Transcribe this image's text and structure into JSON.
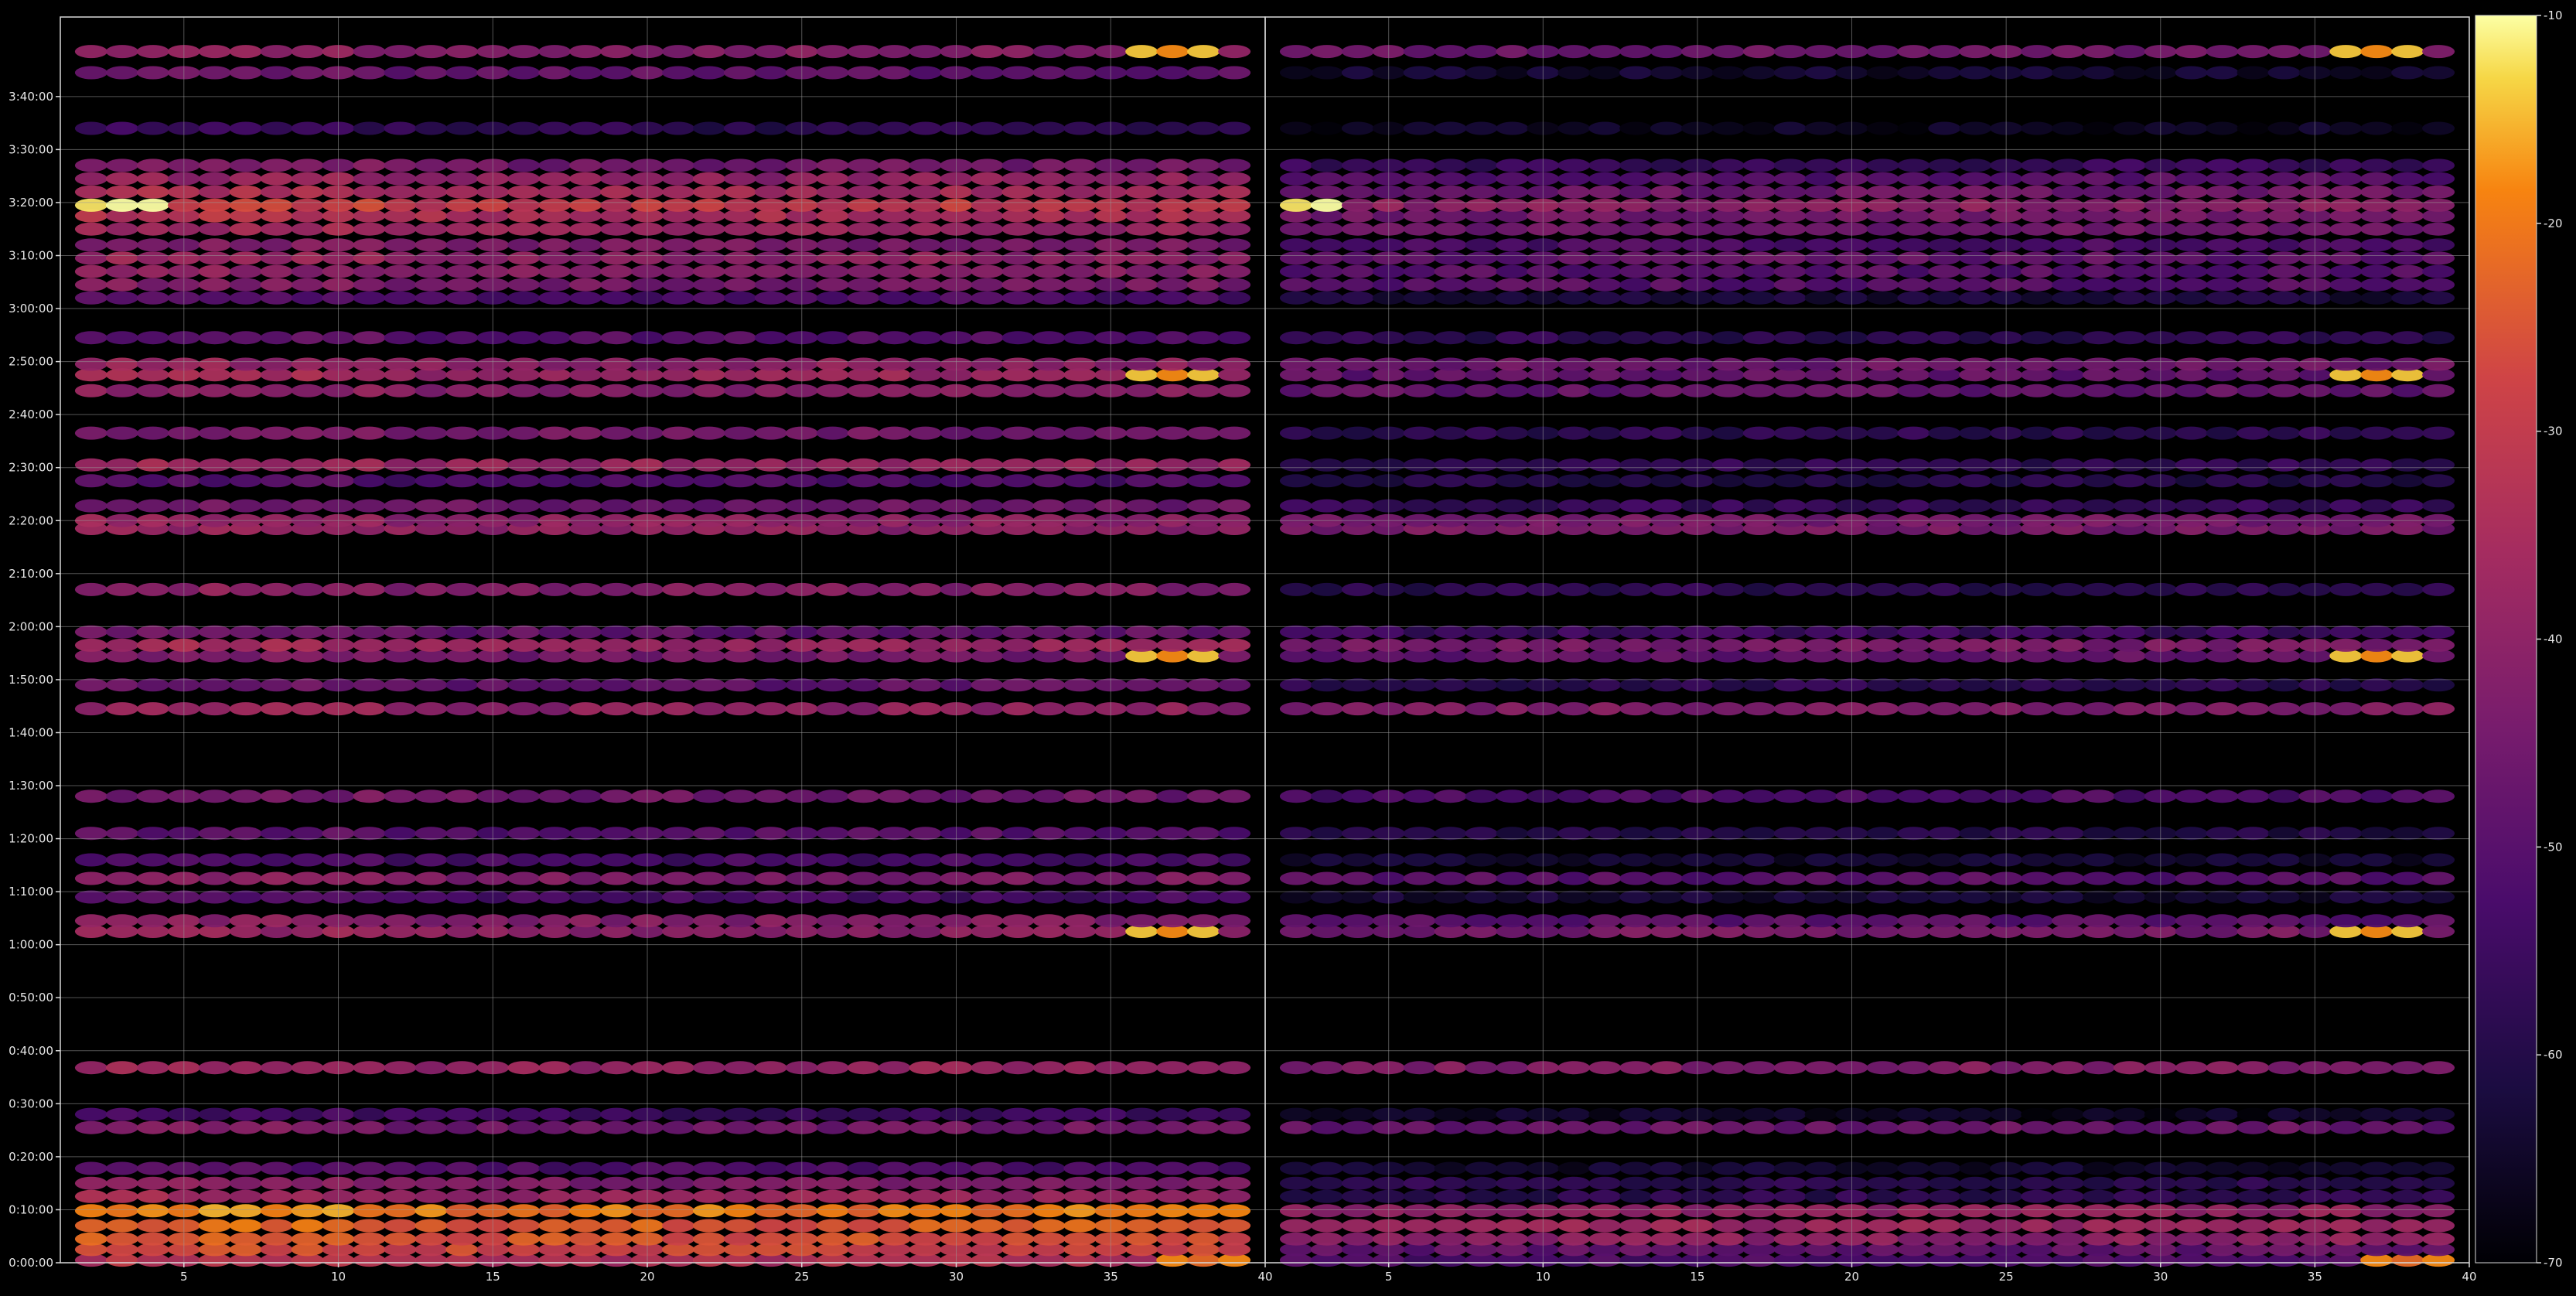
{
  "chart_data": {
    "type": "heatmap",
    "title": "",
    "colorscale": "inferno",
    "background": "#000000",
    "grid": true,
    "panels": [
      {
        "name": "",
        "xlim": [
          1,
          40
        ],
        "xticks": [
          5,
          10,
          15,
          20,
          25,
          30,
          35,
          40
        ],
        "yticks": [
          "0:00:00",
          "0:10:00",
          "0:20:00",
          "0:30:00",
          "0:40:00",
          "0:50:00",
          "1:00:00",
          "1:10:00",
          "1:20:00",
          "1:30:00",
          "1:40:00",
          "1:50:00",
          "2:00:00",
          "2:10:00",
          "2:20:00",
          "2:30:00",
          "2:40:00",
          "2:50:00",
          "3:00:00",
          "3:10:00",
          "3:20:00",
          "3:30:00",
          "3:40:00"
        ]
      },
      {
        "name": "",
        "xlim": [
          1,
          40
        ],
        "xticks": [
          5,
          10,
          15,
          20,
          25,
          30,
          35,
          40
        ],
        "yticks": []
      }
    ],
    "x_values_per_row": "2..39",
    "ylim_minutes": [
      0,
      230
    ],
    "bands": [
      {
        "t_min": 0.5,
        "panel1": -34,
        "panel2": -52,
        "peak": {
          "x": 38,
          "v": -22
        }
      },
      {
        "t_min": 2.5,
        "panel1": -28,
        "panel2": -48
      },
      {
        "t_min": 4.5,
        "panel1": -26,
        "panel2": -40
      },
      {
        "t_min": 7.0,
        "panel1": -24,
        "panel2": -38
      },
      {
        "t_min": 9.8,
        "panel1": -20,
        "panel2": -39
      },
      {
        "t_min": 12.5,
        "panel1": -38,
        "panel2": -58
      },
      {
        "t_min": 15.0,
        "panel1": -43,
        "panel2": -58
      },
      {
        "t_min": 17.8,
        "panel1": -52,
        "panel2": -64
      },
      {
        "t_min": 25.5,
        "panel1": -45,
        "panel2": -47
      },
      {
        "t_min": 28.0,
        "panel1": -55,
        "panel2": -66
      },
      {
        "t_min": 36.8,
        "panel1": -38,
        "panel2": -42
      },
      {
        "t_min": 62.5,
        "panel1": -40,
        "panel2": -44,
        "peak": {
          "x": 37,
          "v": -18
        }
      },
      {
        "t_min": 64.5,
        "panel1": -42,
        "panel2": -49
      },
      {
        "t_min": 69.0,
        "panel1": -53,
        "panel2": -63
      },
      {
        "t_min": 72.5,
        "panel1": -43,
        "panel2": -50
      },
      {
        "t_min": 76.0,
        "panel1": -53,
        "panel2": -64
      },
      {
        "t_min": 81.0,
        "panel1": -50,
        "panel2": -60
      },
      {
        "t_min": 88.0,
        "panel1": -46,
        "panel2": -52
      },
      {
        "t_min": 104.5,
        "panel1": -40,
        "panel2": -42
      },
      {
        "t_min": 109.0,
        "panel1": -48,
        "panel2": -58
      },
      {
        "t_min": 114.5,
        "panel1": -45,
        "panel2": -48,
        "peak": {
          "x": 37,
          "v": -18
        }
      },
      {
        "t_min": 116.5,
        "panel1": -38,
        "panel2": -44
      },
      {
        "t_min": 119.0,
        "panel1": -48,
        "panel2": -55
      },
      {
        "t_min": 127.0,
        "panel1": -42,
        "panel2": -58
      },
      {
        "t_min": 138.5,
        "panel1": -40,
        "panel2": -44
      },
      {
        "t_min": 140.0,
        "panel1": -40,
        "panel2": -45
      },
      {
        "t_min": 142.8,
        "panel1": -46,
        "panel2": -56
      },
      {
        "t_min": 147.5,
        "panel1": -52,
        "panel2": -60
      },
      {
        "t_min": 150.5,
        "panel1": -38,
        "panel2": -57
      },
      {
        "t_min": 156.5,
        "panel1": -45,
        "panel2": -58
      },
      {
        "t_min": 164.5,
        "panel1": -42,
        "panel2": -48
      },
      {
        "t_min": 167.5,
        "panel1": -38,
        "panel2": -48,
        "peak": {
          "x": 37,
          "v": -18
        }
      },
      {
        "t_min": 169.5,
        "panel1": -40,
        "panel2": -46
      },
      {
        "t_min": 174.5,
        "panel1": -50,
        "panel2": -58
      },
      {
        "t_min": 182.0,
        "panel1": -52,
        "panel2": -62
      },
      {
        "t_min": 184.5,
        "panel1": -44,
        "panel2": -50
      },
      {
        "t_min": 187.0,
        "panel1": -42,
        "panel2": -50
      },
      {
        "t_min": 189.5,
        "panel1": -40,
        "panel2": -48
      },
      {
        "t_min": 192.0,
        "panel1": -44,
        "panel2": -52
      },
      {
        "t_min": 195.0,
        "panel1": -38,
        "panel2": -46
      },
      {
        "t_min": 197.5,
        "panel1": -34,
        "panel2": -45
      },
      {
        "t_min": 199.5,
        "panel1": -30,
        "panel2": -40,
        "peak": {
          "x": 2,
          "v": -12
        }
      },
      {
        "t_min": 202.0,
        "panel1": -36,
        "panel2": -46
      },
      {
        "t_min": 204.5,
        "panel1": -40,
        "panel2": -50
      },
      {
        "t_min": 207.0,
        "panel1": -45,
        "panel2": -56
      },
      {
        "t_min": 214.0,
        "panel1": -58,
        "panel2": -66
      },
      {
        "t_min": 224.5,
        "panel1": -48,
        "panel2": -64
      },
      {
        "t_min": 228.5,
        "panel1": -42,
        "panel2": -46,
        "peak": {
          "x": 37,
          "v": -18
        }
      }
    ],
    "colorbar": {
      "range": [
        -70,
        -10
      ],
      "ticks": [
        "-10",
        "-20",
        "-30",
        "-40",
        "-50",
        "-60",
        "-70"
      ]
    }
  }
}
